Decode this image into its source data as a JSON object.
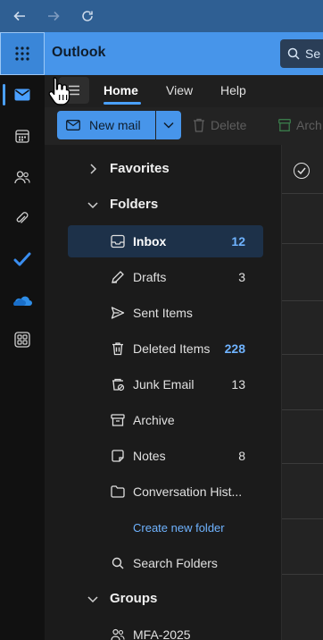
{
  "browser": {
    "back_icon": "back-arrow-icon",
    "forward_icon": "forward-arrow-icon",
    "refresh_icon": "refresh-icon"
  },
  "header": {
    "app_title": "Outlook",
    "search_placeholder": "Se",
    "accent_color": "#4795ea"
  },
  "rail": {
    "items": [
      {
        "name": "mail-icon",
        "active": true
      },
      {
        "name": "calendar-icon",
        "active": false
      },
      {
        "name": "people-icon",
        "active": false
      },
      {
        "name": "attachment-icon",
        "active": false
      },
      {
        "name": "todo-icon",
        "active": false
      },
      {
        "name": "onedrive-icon",
        "active": false
      },
      {
        "name": "apps-icon",
        "active": false
      }
    ]
  },
  "ribbon": {
    "tabs": [
      "Home",
      "View",
      "Help"
    ],
    "active_tab": "Home",
    "new_mail_label": "New mail",
    "delete_label": "Delete",
    "archive_label": "Arch"
  },
  "folders": {
    "favorites_label": "Favorites",
    "folders_label": "Folders",
    "items": [
      {
        "label": "Inbox",
        "count": "12",
        "icon": "inbox-icon",
        "selected": true
      },
      {
        "label": "Drafts",
        "count": "3",
        "icon": "drafts-icon",
        "selected": false
      },
      {
        "label": "Sent Items",
        "count": "",
        "icon": "sent-icon",
        "selected": false
      },
      {
        "label": "Deleted Items",
        "count": "228",
        "icon": "trash-icon",
        "selected": false
      },
      {
        "label": "Junk Email",
        "count": "13",
        "icon": "junk-icon",
        "selected": false
      },
      {
        "label": "Archive",
        "count": "",
        "icon": "archive-icon",
        "selected": false
      },
      {
        "label": "Notes",
        "count": "8",
        "icon": "notes-icon",
        "selected": false
      },
      {
        "label": "Conversation Hist...",
        "count": "",
        "icon": "folder-icon",
        "selected": false
      }
    ],
    "create_new_folder": "Create new folder",
    "search_folders": "Search Folders",
    "groups_label": "Groups",
    "group_items": [
      {
        "label": "MFA-2025",
        "icon": "group-icon"
      }
    ]
  }
}
